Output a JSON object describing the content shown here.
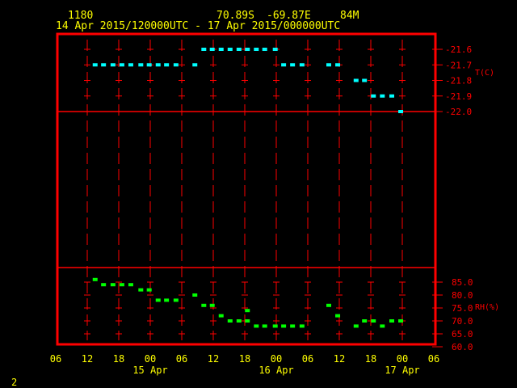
{
  "header": {
    "station_id": "1180",
    "latitude": "70.89S",
    "longitude": "-69.87E",
    "elevation": "84M",
    "time_range": "14 Apr 2015/120000UTC - 17 Apr 2015/000000UTC"
  },
  "footer": {
    "page_number": "2"
  },
  "colors": {
    "frame": "#ff0000",
    "text": "#ffff00",
    "temperature": "#00ffff",
    "humidity": "#00ff00",
    "background": "#000000"
  },
  "chart_data": [
    {
      "type": "scatter",
      "title": "Temperature",
      "ylabel": "T(C)",
      "x_units": "hours since 14 Apr 2015 12Z",
      "xlim": [
        -6,
        66
      ],
      "ylim": [
        -22.05,
        -21.55
      ],
      "y_ticks": [
        -21.6,
        -21.7,
        -21.8,
        -21.9,
        -22.0
      ],
      "y_tick_labels": [
        "-21.6",
        "-21.7",
        "-21.8",
        "-21.9",
        "-22.0"
      ],
      "x": [
        1.5,
        3.1,
        4.9,
        6.6,
        8.3,
        10.2,
        11.8,
        13.5,
        15.1,
        16.9,
        20.5,
        22.2,
        23.8,
        25.5,
        27.2,
        28.9,
        30.5,
        32.2,
        33.8,
        35.8,
        37.4,
        39.1,
        40.9,
        46.0,
        47.7,
        51.2,
        52.8,
        54.5,
        56.2,
        58.0,
        59.7
      ],
      "y": [
        -21.7,
        -21.7,
        -21.7,
        -21.7,
        -21.7,
        -21.7,
        -21.7,
        -21.7,
        -21.7,
        -21.7,
        -21.7,
        -21.6,
        -21.6,
        -21.6,
        -21.6,
        -21.6,
        -21.6,
        -21.6,
        -21.6,
        -21.6,
        -21.7,
        -21.7,
        -21.7,
        -21.7,
        -21.7,
        -21.8,
        -21.8,
        -21.9,
        -21.9,
        -21.9,
        -22.0
      ]
    },
    {
      "type": "scatter",
      "title": "Relative Humidity",
      "ylabel": "RH(%)",
      "x_units": "hours since 14 Apr 2015 12Z",
      "xlim": [
        -6,
        66
      ],
      "ylim": [
        59,
        90
      ],
      "y_ticks": [
        85,
        80,
        75,
        70,
        65,
        60
      ],
      "y_tick_labels": [
        "85.0",
        "80.0",
        "75.0",
        "70.0",
        "65.0",
        "60.0"
      ],
      "x": [
        1.5,
        3.1,
        4.9,
        6.6,
        8.3,
        10.2,
        11.8,
        13.5,
        15.1,
        16.9,
        20.5,
        22.2,
        23.8,
        25.5,
        27.2,
        28.9,
        30.5,
        30.5,
        32.2,
        33.8,
        35.8,
        37.4,
        39.1,
        40.9,
        46.0,
        47.7,
        51.2,
        52.8,
        54.5,
        56.2,
        58.0,
        59.7
      ],
      "y": [
        86,
        84,
        84,
        84,
        84,
        82,
        82,
        78,
        78,
        78,
        80,
        76,
        76,
        72,
        70,
        70,
        70,
        74,
        68,
        68,
        68,
        68,
        68,
        68,
        76,
        72,
        68,
        70,
        70,
        68,
        70,
        70
      ]
    }
  ],
  "x_axis": {
    "tick_hours": [
      -6,
      0,
      6,
      12,
      18,
      24,
      30,
      36,
      42,
      48,
      54,
      60,
      66
    ],
    "tick_labels": [
      "06",
      "12",
      "18",
      "00",
      "06",
      "12",
      "18",
      "00",
      "06",
      "12",
      "18",
      "00",
      "06"
    ],
    "date_labels": [
      {
        "hour": 12,
        "label": "15 Apr"
      },
      {
        "hour": 36,
        "label": "16 Apr"
      },
      {
        "hour": 60,
        "label": "17 Apr"
      }
    ]
  }
}
